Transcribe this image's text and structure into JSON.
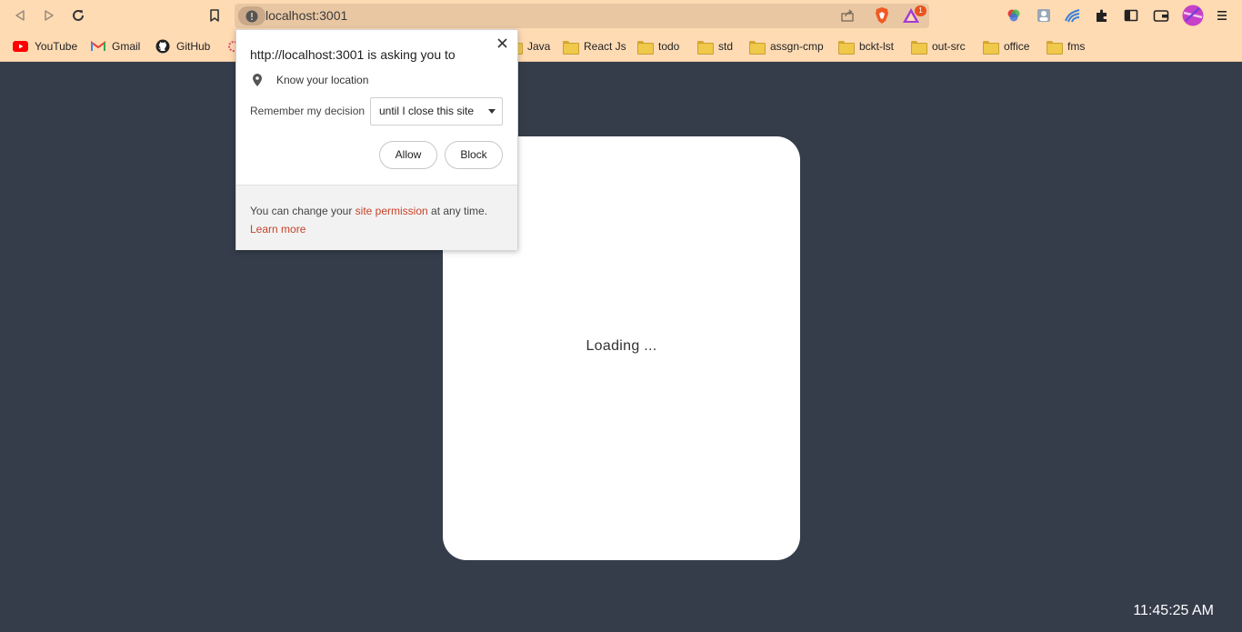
{
  "browser": {
    "url": "localhost:3001",
    "bookmarks": [
      {
        "label": "YouTube",
        "icon": "youtube-icon"
      },
      {
        "label": "Gmail",
        "icon": "gmail-icon"
      },
      {
        "label": "GitHub",
        "icon": "github-icon"
      },
      {
        "label": "Java",
        "icon": "folder-icon"
      },
      {
        "label": "React Js",
        "icon": "folder-icon"
      },
      {
        "label": "todo",
        "icon": "folder-icon"
      },
      {
        "label": "std",
        "icon": "folder-icon"
      },
      {
        "label": "assgn-cmp",
        "icon": "folder-icon"
      },
      {
        "label": "bckt-lst",
        "icon": "folder-icon"
      },
      {
        "label": "out-src",
        "icon": "folder-icon"
      },
      {
        "label": "office",
        "icon": "folder-icon"
      },
      {
        "label": "fms",
        "icon": "folder-icon"
      }
    ],
    "rewards_badge": "1",
    "toolbar_color": "#ffdbb4"
  },
  "permission_popup": {
    "title": "http://localhost:3001 is asking you to",
    "permission": "Know your location",
    "remember_label": "Remember my decision",
    "remember_value": "until I close this site",
    "allow_label": "Allow",
    "block_label": "Block",
    "footer_prefix": "You can change your ",
    "footer_link": "site permission",
    "footer_suffix": " at any time.",
    "learn_more": "Learn more",
    "link_color": "#c5442b"
  },
  "page": {
    "loading_text": "Loading ...",
    "clock": "11:45:25 AM",
    "background": "#353d4b"
  }
}
